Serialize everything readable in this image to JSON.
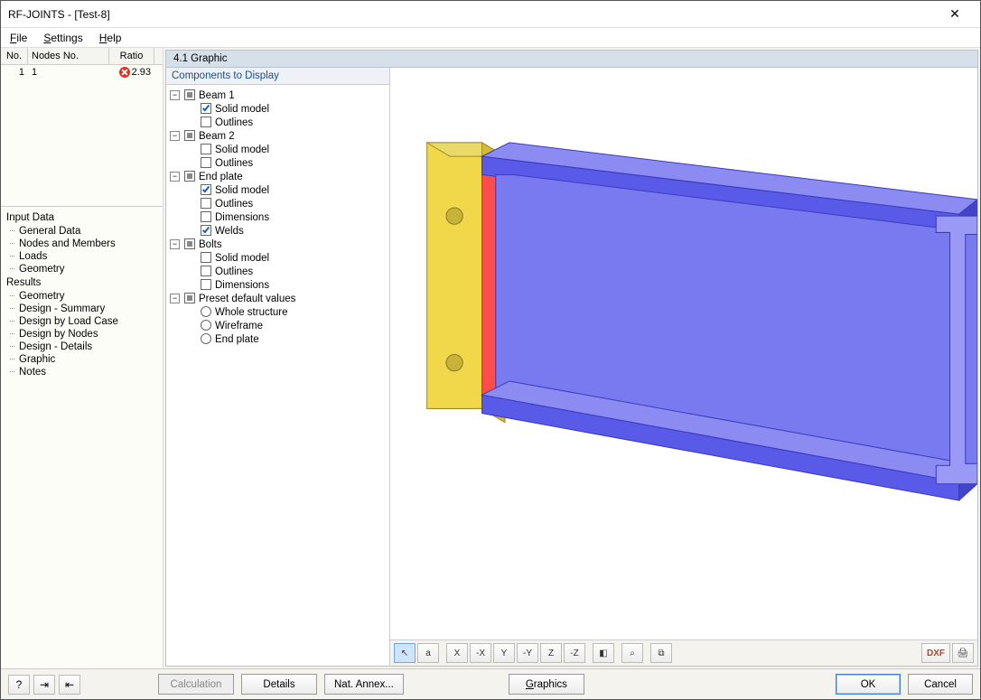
{
  "window_title": "RF-JOINTS - [Test-8]",
  "menu": {
    "file": "File",
    "settings": "Settings",
    "help": "Help"
  },
  "nodes_table": {
    "h_no": "No.",
    "h_nodes": "Nodes No.",
    "h_ratio": "Ratio",
    "row_no": "1",
    "row_nodes": "1",
    "row_ratio": "2.93"
  },
  "nav": {
    "input": "Input Data",
    "general": "General Data",
    "nodes_members": "Nodes and Members",
    "loads": "Loads",
    "geometry": "Geometry",
    "results": "Results",
    "r_geometry": "Geometry",
    "r_summary": "Design - Summary",
    "r_loadcase": "Design by Load Case",
    "r_nodes": "Design by Nodes",
    "r_details": "Design - Details",
    "r_graphic": "Graphic",
    "r_notes": "Notes"
  },
  "section_title": "4.1 Graphic",
  "comp_hdr": "Components to Display",
  "tree": {
    "beam1": "Beam 1",
    "beam2": "Beam 2",
    "endplate": "End plate",
    "bolts": "Bolts",
    "preset": "Preset default values",
    "solid": "Solid model",
    "outlines": "Outlines",
    "dimensions": "Dimensions",
    "welds": "Welds",
    "whole": "Whole structure",
    "wire": "Wireframe",
    "endplate_r": "End plate"
  },
  "toolbar": {
    "t1": "",
    "t2": "a",
    "t3": "X",
    "t4": "-X",
    "t5": "Y",
    "t6": "-Y",
    "t7": "Z",
    "t8": "-Z",
    "t9": "",
    "t10": "",
    "t11": "",
    "dxf": "DXF",
    "print": ""
  },
  "buttons": {
    "calc": "Calculation",
    "details": "Details",
    "annex": "Nat. Annex...",
    "graphics": "Graphics",
    "ok": "OK",
    "cancel": "Cancel"
  }
}
